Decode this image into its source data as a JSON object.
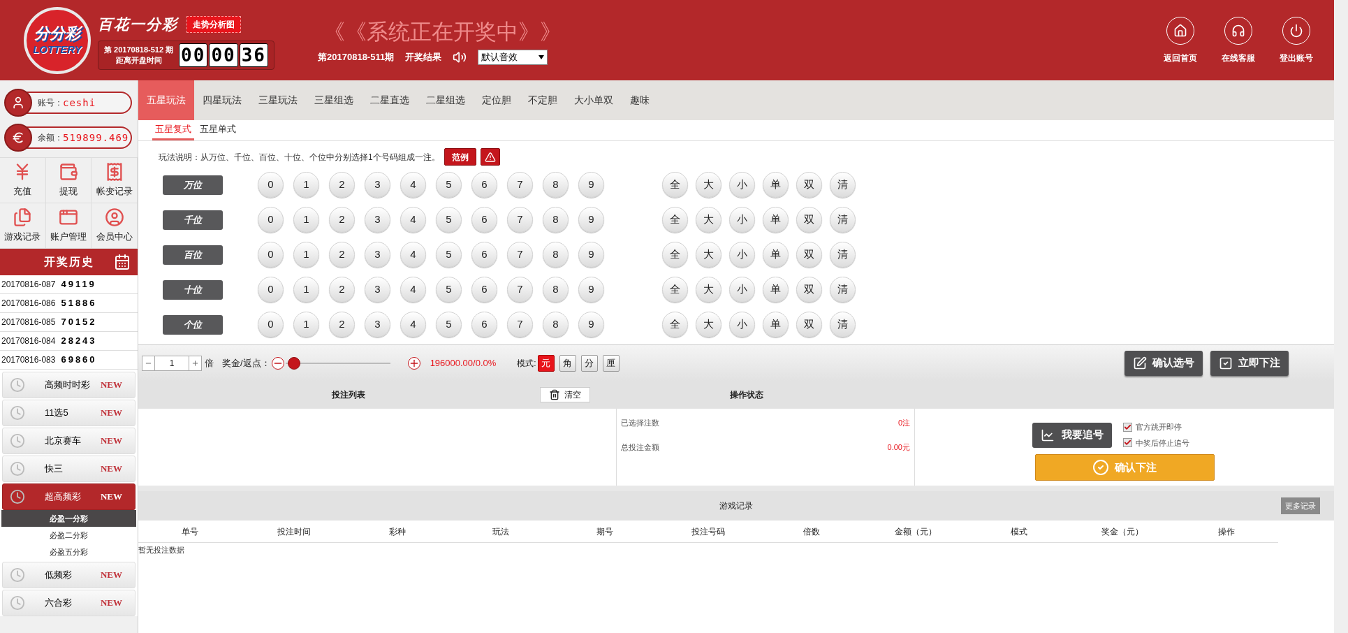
{
  "header": {
    "logo": {
      "text": "分分彩",
      "subtext": "LOTTERY"
    },
    "title": "百花一分彩",
    "trend_button": "走势分析图",
    "current_period": {
      "prefix": "第",
      "number": "20170818-512",
      "suffix": "期",
      "caption": "距离开盘时间"
    },
    "timer": [
      "00",
      "00",
      "36"
    ],
    "status_banner": "《《系统正在开奖中》》",
    "last_period": "第20170818-511期",
    "result_label": "开奖结果",
    "sound_select": {
      "value": "默认音效"
    },
    "nav": [
      {
        "label": "返回首页",
        "kind": "home"
      },
      {
        "label": "在线客服",
        "kind": "support"
      },
      {
        "label": "登出账号",
        "kind": "logout"
      }
    ]
  },
  "account": {
    "username_label": "账号：",
    "username": "ceshi",
    "balance_label": "余额：",
    "balance": "519899.469"
  },
  "shortcuts": [
    {
      "label": "充值",
      "kind": "deposit"
    },
    {
      "label": "提现",
      "kind": "withdraw"
    },
    {
      "label": "帐变记录",
      "kind": "ledger"
    },
    {
      "label": "游戏记录",
      "kind": "records"
    },
    {
      "label": "账户管理",
      "kind": "account"
    },
    {
      "label": "会员中心",
      "kind": "member"
    }
  ],
  "history": {
    "title": "开奖历史",
    "rows": [
      {
        "period": "20170816-087",
        "numbers": "49119"
      },
      {
        "period": "20170816-086",
        "numbers": "51886"
      },
      {
        "period": "20170816-085",
        "numbers": "70152"
      },
      {
        "period": "20170816-084",
        "numbers": "28243"
      },
      {
        "period": "20170816-083",
        "numbers": "69860"
      }
    ]
  },
  "lottery_menu": [
    {
      "label": "高频时时彩",
      "badge": "NEW",
      "selected": false
    },
    {
      "label": "11选5",
      "badge": "NEW",
      "selected": false
    },
    {
      "label": "北京赛车",
      "badge": "NEW",
      "selected": false
    },
    {
      "label": "快三",
      "badge": "NEW",
      "selected": false
    },
    {
      "label": "超高频彩",
      "badge": "NEW",
      "selected": true,
      "children": [
        {
          "label": "必盈一分彩",
          "selected": true
        },
        {
          "label": "必盈二分彩",
          "selected": false
        },
        {
          "label": "必盈五分彩",
          "selected": false
        }
      ]
    },
    {
      "label": "低频彩",
      "badge": "NEW",
      "selected": false
    },
    {
      "label": "六合彩",
      "badge": "NEW",
      "selected": false
    }
  ],
  "play_tabs": [
    {
      "label": "五星玩法",
      "selected": true
    },
    {
      "label": "四星玩法",
      "selected": false
    },
    {
      "label": "三星玩法",
      "selected": false
    },
    {
      "label": "三星组选",
      "selected": false
    },
    {
      "label": "二星直选",
      "selected": false
    },
    {
      "label": "二星组选",
      "selected": false
    },
    {
      "label": "定位胆",
      "selected": false
    },
    {
      "label": "不定胆",
      "selected": false
    },
    {
      "label": "大小单双",
      "selected": false
    },
    {
      "label": "趣味",
      "selected": false
    }
  ],
  "sub_tabs": [
    {
      "label": "五星复式",
      "selected": true
    },
    {
      "label": "五星单式",
      "selected": false
    }
  ],
  "instructions": {
    "text": "玩法说明：从万位、千位、百位、十位、个位中分别选择1个号码组成一注。",
    "example_button": "范例"
  },
  "positions": [
    {
      "label": "万位",
      "balls": [
        "0",
        "1",
        "2",
        "3",
        "4",
        "5",
        "6",
        "7",
        "8",
        "9"
      ],
      "quick": [
        "全",
        "大",
        "小",
        "单",
        "双",
        "清"
      ]
    },
    {
      "label": "千位",
      "balls": [
        "0",
        "1",
        "2",
        "3",
        "4",
        "5",
        "6",
        "7",
        "8",
        "9"
      ],
      "quick": [
        "全",
        "大",
        "小",
        "单",
        "双",
        "清"
      ]
    },
    {
      "label": "百位",
      "balls": [
        "0",
        "1",
        "2",
        "3",
        "4",
        "5",
        "6",
        "7",
        "8",
        "9"
      ],
      "quick": [
        "全",
        "大",
        "小",
        "单",
        "双",
        "清"
      ]
    },
    {
      "label": "十位",
      "balls": [
        "0",
        "1",
        "2",
        "3",
        "4",
        "5",
        "6",
        "7",
        "8",
        "9"
      ],
      "quick": [
        "全",
        "大",
        "小",
        "单",
        "双",
        "清"
      ]
    },
    {
      "label": "个位",
      "balls": [
        "0",
        "1",
        "2",
        "3",
        "4",
        "5",
        "6",
        "7",
        "8",
        "9"
      ],
      "quick": [
        "全",
        "大",
        "小",
        "单",
        "双",
        "清"
      ]
    }
  ],
  "bet_controls": {
    "multiplier": "1",
    "multiplier_unit": "倍",
    "rebate_label": "奖金/返点：",
    "rebate": {
      "level": 0.08
    },
    "prize": "196000.00/0.0%",
    "mode_label": "模式:",
    "modes": [
      {
        "label": "元",
        "selected": true
      },
      {
        "label": "角",
        "selected": false
      },
      {
        "label": "分",
        "selected": false
      },
      {
        "label": "厘",
        "selected": false
      }
    ],
    "buttons": [
      {
        "label": "确认选号",
        "kind": "confirm"
      },
      {
        "label": "立即下注",
        "kind": "bet"
      }
    ]
  },
  "bet_list": {
    "title": "投注列表",
    "clear_button": "清空",
    "status_title": "操作状态",
    "stats": [
      {
        "label": "已选择注数",
        "value": "0注"
      },
      {
        "label": "总投注金额",
        "value": "0.00元"
      }
    ],
    "chase_button": "我要追号",
    "options": [
      {
        "label": "官方跳开即停",
        "checked": true
      },
      {
        "label": "中奖后停止追号",
        "checked": true
      }
    ],
    "confirm_button": "确认下注"
  },
  "records": {
    "title": "游戏记录",
    "more_button": "更多记录",
    "columns": [
      "单号",
      "投注时间",
      "彩种",
      "玩法",
      "期号",
      "投注号码",
      "倍数",
      "金额（元）",
      "模式",
      "奖金（元）",
      "操作"
    ],
    "empty": "暂无投注数据"
  }
}
